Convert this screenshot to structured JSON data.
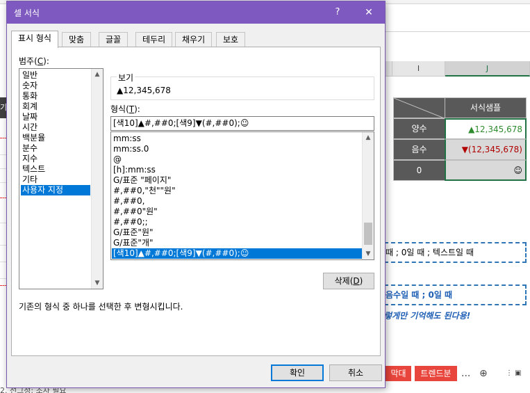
{
  "excel_bg": {
    "columns": [
      {
        "label": "I",
        "selected": false
      },
      {
        "label": "J",
        "selected": true
      }
    ],
    "left_cut_label": "기",
    "table": {
      "header": "서식샘플",
      "rows": [
        {
          "label": "양수",
          "value": "▲12,345,678",
          "sign": "up"
        },
        {
          "label": "음수",
          "value": "▼(12,345,678)",
          "sign": "down"
        },
        {
          "label": "0",
          "value": "☺",
          "sign": "zero"
        }
      ]
    },
    "note1": "때 ; 0일 때 ; 텍스트일 때",
    "note2": "음수일 때 ; 0일 때",
    "note3": "렇게만 기억해도 된다용!",
    "sheet_tabs": [
      "막대",
      "트렌드분"
    ],
    "tab_more": "...",
    "tab_add": "⊕",
    "bottom_text": "2. 선그정: 조자 필요"
  },
  "dialog": {
    "title": "셀 서식",
    "help": "?",
    "close": "✕",
    "tabs": [
      {
        "label": "표시 형식",
        "active": true
      },
      {
        "label": "맞춤",
        "active": false
      },
      {
        "label": "글꼴",
        "active": false
      },
      {
        "label": "테두리",
        "active": false
      },
      {
        "label": "채우기",
        "active": false
      },
      {
        "label": "보호",
        "active": false
      }
    ],
    "category_label": "범주(",
    "category_key": "C",
    "category_label_end": "):",
    "categories": [
      {
        "label": "일반",
        "selected": false
      },
      {
        "label": "숫자",
        "selected": false
      },
      {
        "label": "통화",
        "selected": false
      },
      {
        "label": "회계",
        "selected": false
      },
      {
        "label": "날짜",
        "selected": false
      },
      {
        "label": "시간",
        "selected": false
      },
      {
        "label": "백분율",
        "selected": false
      },
      {
        "label": "분수",
        "selected": false
      },
      {
        "label": "지수",
        "selected": false
      },
      {
        "label": "텍스트",
        "selected": false
      },
      {
        "label": "기타",
        "selected": false
      },
      {
        "label": "사용자 지정",
        "selected": true
      }
    ],
    "preview_label": "보기",
    "preview_value": "▲12,345,678",
    "format_label": "형식(",
    "format_key": "T",
    "format_label_end": "):",
    "format_input": "[색10]▲#,##0;[색9]▼(#,##0);☺",
    "formats": [
      {
        "label": "mm:ss",
        "selected": false
      },
      {
        "label": "mm:ss.0",
        "selected": false
      },
      {
        "label": "@",
        "selected": false
      },
      {
        "label": "[h]:mm:ss",
        "selected": false
      },
      {
        "label": "G/표준 \"페이지\"",
        "selected": false
      },
      {
        "label": "#,##0,\"천\"\"원\"",
        "selected": false
      },
      {
        "label": "#,##0,",
        "selected": false
      },
      {
        "label": "#,##0\"원\"",
        "selected": false
      },
      {
        "label": "#,##0;;",
        "selected": false
      },
      {
        "label": "G/표준\"원\"",
        "selected": false
      },
      {
        "label": "G/표준\"개\"",
        "selected": false
      },
      {
        "label": "[색10]▲#,##0;[색9]▼(#,##0);☺",
        "selected": true
      }
    ],
    "delete_label": "삭제(",
    "delete_key": "D",
    "delete_label_end": ")",
    "hint": "기존의 형식 중 하나를 선택한 후 변형시킵니다.",
    "ok_label": "확인",
    "cancel_label": "취소"
  },
  "colors": {
    "title_bar": "#7e5ac0",
    "selection": "#0078d7",
    "positive": "#2e8b2e",
    "negative": "#b00000",
    "sheet_tab": "#e8453c"
  },
  "icons": {
    "scroll_up": "chevron-up-icon",
    "scroll_down": "chevron-down-icon",
    "close": "close-icon",
    "help": "help-icon"
  }
}
